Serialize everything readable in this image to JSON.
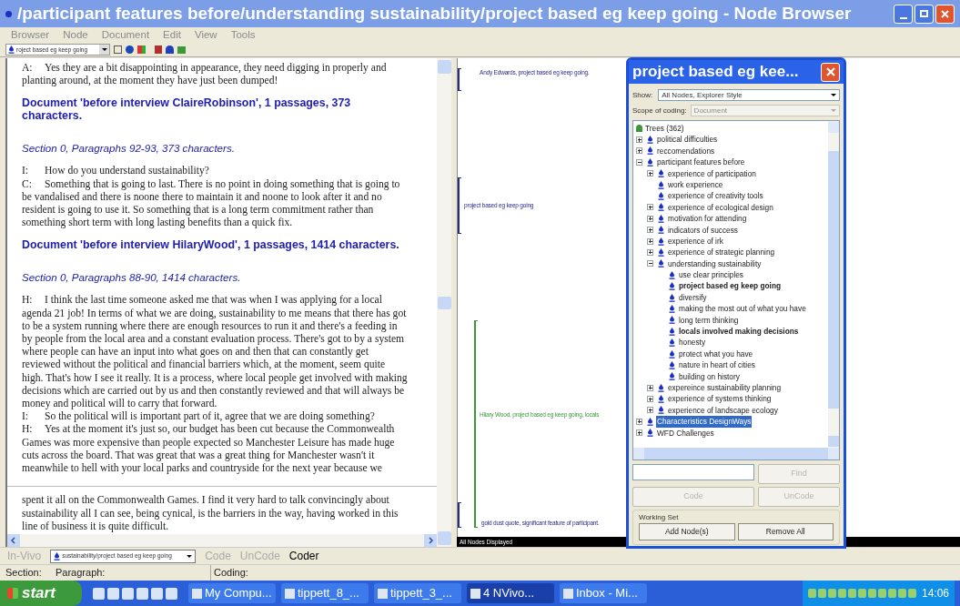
{
  "window": {
    "title": "/participant features before/understanding sustainability/project based eg keep going - Node Browser"
  },
  "menu": [
    "Browser",
    "Node",
    "Document",
    "Edit",
    "View",
    "Tools"
  ],
  "toolbar": {
    "node_combo": "roject based eg keep going"
  },
  "document": {
    "blocks": [
      {
        "kind": "speech",
        "speaker": "A:",
        "text": "Yes they are a bit disappointing in appearance, they need digging in properly and planting around, at the moment they have just been dumped!"
      },
      {
        "kind": "doc_heading",
        "text": "Document 'before interview ClaireRobinson',  1 passages, 373 characters."
      },
      {
        "kind": "section",
        "text": "Section 0, Paragraphs 92-93, 373 characters."
      },
      {
        "kind": "speech",
        "speaker": "I:",
        "text": "How do you understand sustainability?"
      },
      {
        "kind": "speech",
        "speaker": "C:",
        "text": "Something that is going to last.  There is no point in doing something that is going to be vandalised and there is noone there to maintain it and noone to look after it and no resident is going to use it.  So something that is a long term commitment rather than something short term with long lasting benefits than a quick fix."
      },
      {
        "kind": "doc_heading",
        "text": "Document 'before interview HilaryWood',  1 passages, 1414 characters."
      },
      {
        "kind": "section",
        "text": "Section 0, Paragraphs 88-90, 1414 characters."
      },
      {
        "kind": "speech",
        "speaker": "H:",
        "text": "I think the last time someone asked me that was when I was applying for a local agenda 21 job!  In terms of what we are doing, sustainability to me means that there has got to be a system running where there are enough resources to run it and there's a feeding in by people from the local area and a constant evaluation process.  There's got to by a system where people can have an input into what goes on and then that can constantly get reviewed without the political and financial barriers which, at the moment, seem quite high.  That's how I see it really.  It is a process, where local people get involved with making decisions which are carried out by us and then constantly reviewed and that will always be money and political will to carry that forward."
      },
      {
        "kind": "speech",
        "speaker": "I:",
        "text": "So the political will is important part  of it, agree that we are doing something?"
      },
      {
        "kind": "speech",
        "speaker": "H:",
        "text": "Yes at the moment it's just so, our budget has been cut because the Commonwealth Games was more expensive than people expected so Manchester Leisure has made huge cuts across the board.  That was great that was a great thing for Manchester wasn't it meanwhile to hell with your local parks and countryside for the next year because we"
      }
    ],
    "lower_blocks": [
      {
        "kind": "continuation",
        "text": "spent it all on the Commonwealth Games.  I find it very hard to talk convincingly about sustainability all I can see, being cynical, is the barriers in the way, having worked in this line of business it is quite difficult."
      }
    ]
  },
  "coding_stripes": {
    "stripes": [
      {
        "label": "Andy Edwards, project based eg keep going.",
        "color": "#2a2a8c"
      },
      {
        "label": "project based eg keep going",
        "color": "#2a2a8c"
      },
      {
        "label": "Hilary Wood, project based eg keep going, locals",
        "color": "#3c9a3c"
      },
      {
        "label": "gold dust quote, significant feature of participant.",
        "color": "#2a2a8c"
      }
    ],
    "status": "All Nodes Displayed"
  },
  "node_dialog": {
    "title": "project based eg kee...",
    "show_label": "Show:",
    "show_value": "All Nodes, Explorer Style",
    "scope_label": "Scope of coding:",
    "scope_value": "Document",
    "scope_disabled": true,
    "tree": {
      "label": "Trees (362)",
      "children": [
        {
          "label": "political difficulties",
          "expandable": true,
          "expanded": false,
          "bold": false,
          "selected": false
        },
        {
          "label": "reccomendations",
          "expandable": true,
          "expanded": false,
          "bold": false,
          "selected": false
        },
        {
          "label": "participant features before",
          "expandable": true,
          "expanded": true,
          "bold": false,
          "selected": false,
          "children": [
            {
              "label": "experience of participation",
              "expandable": true,
              "expanded": false,
              "bold": false,
              "selected": false
            },
            {
              "label": "work experience",
              "expandable": false,
              "expanded": false,
              "bold": false,
              "selected": false
            },
            {
              "label": "experience of creativity tools",
              "expandable": false,
              "expanded": false,
              "bold": false,
              "selected": false
            },
            {
              "label": "experience of ecological design",
              "expandable": true,
              "expanded": false,
              "bold": false,
              "selected": false
            },
            {
              "label": "motivation for attending",
              "expandable": true,
              "expanded": false,
              "bold": false,
              "selected": false
            },
            {
              "label": "indicators of success",
              "expandable": true,
              "expanded": false,
              "bold": false,
              "selected": false
            },
            {
              "label": "experience of irk",
              "expandable": true,
              "expanded": false,
              "bold": false,
              "selected": false
            },
            {
              "label": "experience of strategic planning",
              "expandable": true,
              "expanded": false,
              "bold": false,
              "selected": false
            },
            {
              "label": "understanding sustainability",
              "expandable": true,
              "expanded": true,
              "bold": false,
              "selected": false,
              "children": [
                {
                  "label": "use clear principles",
                  "expandable": false,
                  "expanded": false,
                  "bold": false,
                  "selected": false
                },
                {
                  "label": "project based eg keep going",
                  "expandable": false,
                  "expanded": false,
                  "bold": true,
                  "selected": false
                },
                {
                  "label": "diversify",
                  "expandable": false,
                  "expanded": false,
                  "bold": false,
                  "selected": false
                },
                {
                  "label": "making the most out of what you have",
                  "expandable": false,
                  "expanded": false,
                  "bold": false,
                  "selected": false
                },
                {
                  "label": "long term thinking",
                  "expandable": false,
                  "expanded": false,
                  "bold": false,
                  "selected": false
                },
                {
                  "label": "locals involved making decisions",
                  "expandable": false,
                  "expanded": false,
                  "bold": true,
                  "selected": false
                },
                {
                  "label": "honesty",
                  "expandable": false,
                  "expanded": false,
                  "bold": false,
                  "selected": false
                },
                {
                  "label": "protect what you have",
                  "expandable": false,
                  "expanded": false,
                  "bold": false,
                  "selected": false
                },
                {
                  "label": "nature in heart of cities",
                  "expandable": false,
                  "expanded": false,
                  "bold": false,
                  "selected": false
                },
                {
                  "label": "building on history",
                  "expandable": false,
                  "expanded": false,
                  "bold": false,
                  "selected": false
                }
              ]
            },
            {
              "label": "expereince sustainability planning",
              "expandable": true,
              "expanded": false,
              "bold": false,
              "selected": false
            },
            {
              "label": "experience of systems thinking",
              "expandable": true,
              "expanded": false,
              "bold": false,
              "selected": false
            },
            {
              "label": "experience of landscape ecology",
              "expandable": true,
              "expanded": false,
              "bold": false,
              "selected": false
            }
          ]
        },
        {
          "label": "Characteristics DesignWays",
          "expandable": true,
          "expanded": false,
          "bold": false,
          "selected": true
        },
        {
          "label": "WFD Challenges",
          "expandable": true,
          "expanded": false,
          "bold": false,
          "selected": false
        }
      ]
    },
    "find_button": {
      "label": "Find",
      "disabled": true
    },
    "code_button": {
      "label": "Code",
      "disabled": true
    },
    "uncode_button": {
      "label": "UnCode",
      "disabled": true
    },
    "working_set": {
      "title": "Working Set",
      "buttons": [
        "Add Node(s)",
        "Remove All"
      ]
    }
  },
  "coder_bar": {
    "invivo": {
      "label": "In-Vivo",
      "disabled": true
    },
    "node_path": "sustainability/project based eg keep going",
    "code": {
      "label": "Code",
      "disabled": true
    },
    "uncode": {
      "label": "UnCode",
      "disabled": true
    },
    "coder": {
      "label": "Coder",
      "disabled": false
    }
  },
  "status_bar": [
    "Section:",
    "Paragraph:",
    "Coding:"
  ],
  "taskbar": {
    "start": "start",
    "tasks": [
      {
        "label": "My Compu...",
        "selected": false
      },
      {
        "label": "tippett_8_...",
        "selected": false
      },
      {
        "label": "tippett_3_...",
        "selected": false
      },
      {
        "label": "4 NVivo...",
        "selected": true
      },
      {
        "label": "Inbox - Mi...",
        "selected": false
      }
    ],
    "clock": "14:06"
  }
}
